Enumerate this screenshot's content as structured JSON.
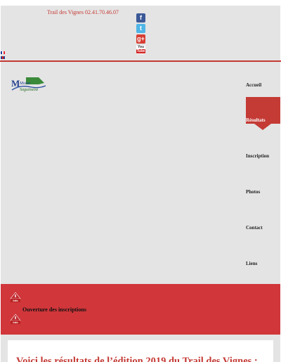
{
  "header": {
    "contact": "Trail des Vignes 02.41.70.46.07",
    "social": [
      {
        "name": "facebook-icon",
        "glyph": "f"
      },
      {
        "name": "twitter-icon",
        "glyph": "t"
      },
      {
        "name": "google-plus-icon",
        "glyph": "g+"
      },
      {
        "name": "youtube-icon",
        "you": "You",
        "tube": "Tube"
      }
    ],
    "languages": [
      "french-flag-icon",
      "english-flag-icon"
    ]
  },
  "logo": {
    "text_main": "Moine",
    "text_sub": "Saguinaise"
  },
  "nav": {
    "items": [
      {
        "label": "Accueil"
      },
      {
        "label": "Résultats",
        "active": true
      },
      {
        "label": "Inscription"
      },
      {
        "label": "Photos"
      },
      {
        "label": "Contact"
      },
      {
        "label": "Liens"
      }
    ]
  },
  "banner": {
    "badge": "Info",
    "text": "Ouverture des inscriptions"
  },
  "content": {
    "title": "Voici les résultats de l’édition 2019 du Trail des Vignes :"
  },
  "colors": {
    "accent": "#c43a35",
    "banner": "#d0363a",
    "panel": "#e4e4e4"
  }
}
